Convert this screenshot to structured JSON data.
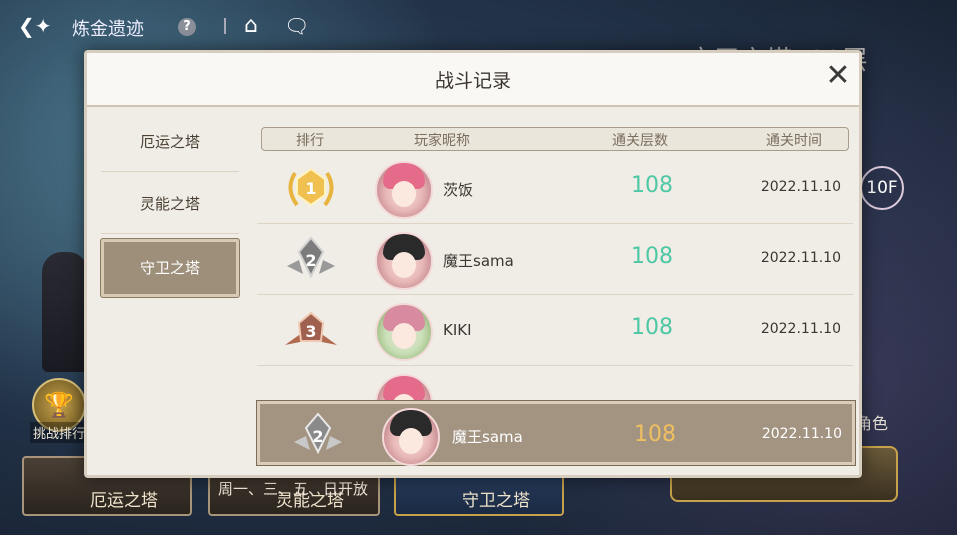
{
  "header": {
    "title": "炼金遗迹",
    "help_label": "?"
  },
  "background": {
    "tower_title": "守卫之塔108层",
    "floor_indicator": "10F",
    "role_label": "角色",
    "challenge_rank_label": "挑战排行",
    "bottom_tabs": [
      {
        "label": "厄运之塔"
      },
      {
        "label": "灵能之塔"
      },
      {
        "label": "守卫之塔"
      }
    ],
    "open_days": "周一、三、五、日开放"
  },
  "modal": {
    "title": "战斗记录",
    "sidebar": [
      {
        "label": "厄运之塔",
        "active": false
      },
      {
        "label": "灵能之塔",
        "active": false
      },
      {
        "label": "守卫之塔",
        "active": true
      }
    ],
    "columns": {
      "rank": "排行",
      "nickname": "玩家昵称",
      "floors": "通关层数",
      "time": "通关时间"
    },
    "rows": [
      {
        "rank": "1",
        "nickname": "茨饭",
        "floors": "108",
        "time": "2022.11.10"
      },
      {
        "rank": "2",
        "nickname": "魔王sama",
        "floors": "108",
        "time": "2022.11.10"
      },
      {
        "rank": "3",
        "nickname": "KIKI",
        "floors": "108",
        "time": "2022.11.10"
      }
    ],
    "my_record": {
      "rank": "2",
      "nickname": "魔王sama",
      "floors": "108",
      "time": "2022.11.10"
    }
  },
  "colors": {
    "floors_green": "#4dc7a4",
    "my_floors_gold": "#f0c060",
    "rank1_gold": "#e8b440",
    "rank2_silver": "#8a8a8a",
    "rank3_bronze": "#b06a50"
  }
}
